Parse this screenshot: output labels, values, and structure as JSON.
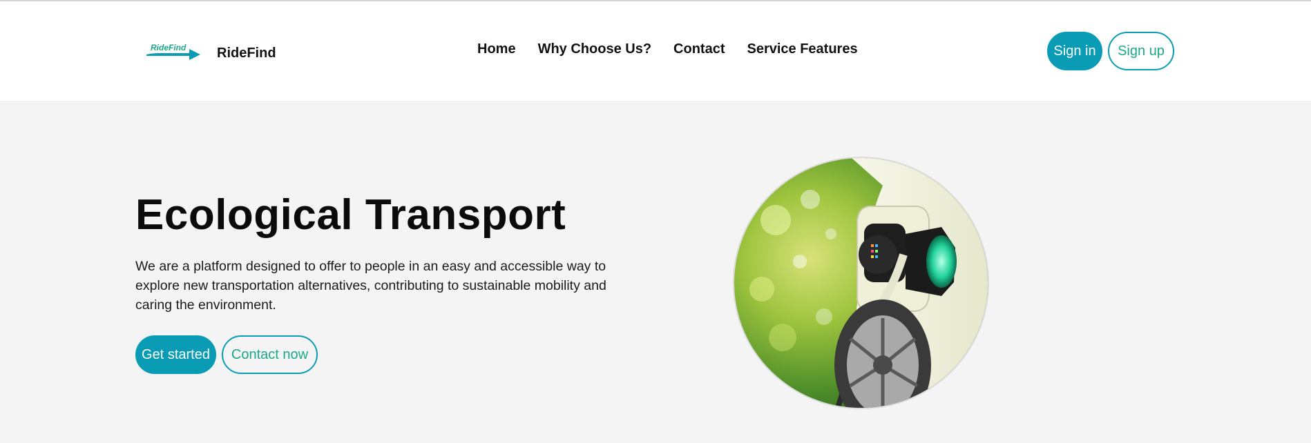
{
  "header": {
    "brand_logo_text": "RideFind",
    "brand_name": "RideFind",
    "nav": [
      {
        "label": "Home"
      },
      {
        "label": "Why Choose Us?"
      },
      {
        "label": "Contact"
      },
      {
        "label": "Service Features"
      }
    ],
    "sign_in_label": "Sign in",
    "sign_up_label": "Sign up"
  },
  "hero": {
    "title": "Ecological Transport",
    "description": "We are a platform designed to offer to people in an easy and accessible way to explore new transportation alternatives, contributing to sustainable mobility and caring the environment.",
    "get_started_label": "Get started",
    "contact_now_label": "Contact now",
    "image_alt": "Electric car charging"
  },
  "colors": {
    "accent": "#0a9cb4",
    "accent_text": "#1aa889",
    "hero_bg": "#f4f4f4"
  },
  "icons": [
    "ridefind-logo-icon"
  ]
}
